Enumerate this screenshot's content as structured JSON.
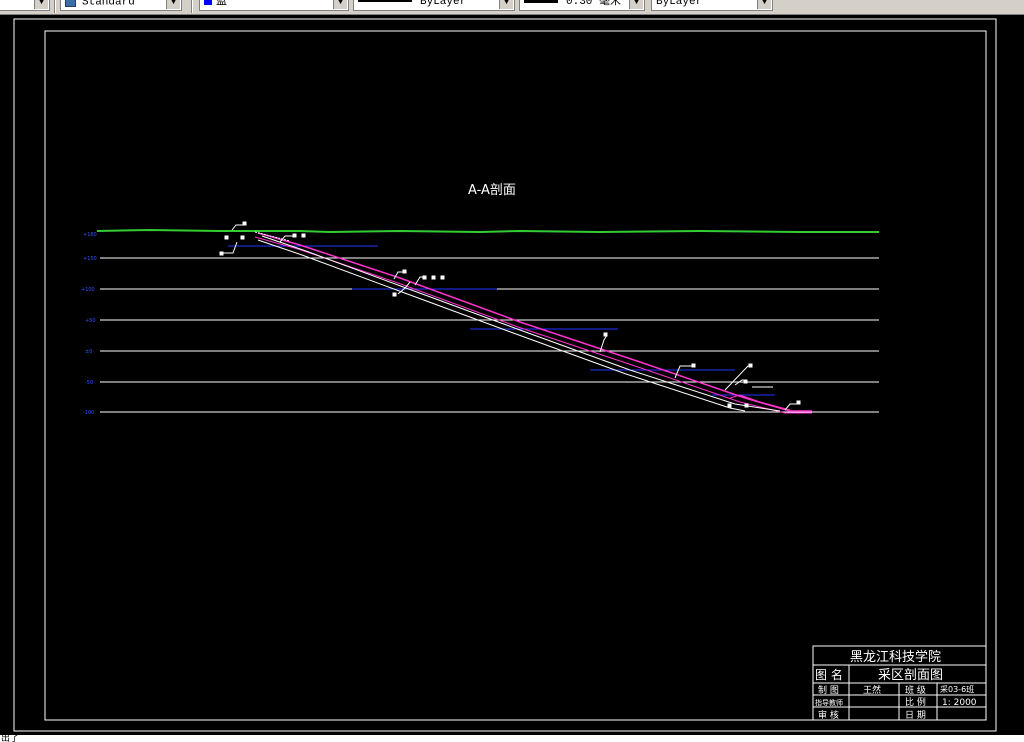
{
  "toolbar": {
    "text_style": "Standard",
    "color": "蓝",
    "color_hex": "#0000ff",
    "linetype": "ByLayer",
    "lineweight": "0.30 毫米",
    "plotstyle": "ByLayer"
  },
  "drawing": {
    "section_title": "A-A剖面",
    "elevation_labels": [
      "+180",
      "+150",
      "+100",
      "+50",
      "±0",
      "-50",
      "-100"
    ],
    "colors": {
      "background": "#000000",
      "border": "#ffffff",
      "ground_line": "#33cc33",
      "elevation_text": "#3355ff",
      "roadway_outer": "#ff33cc",
      "roadway_inner": "#ffffff",
      "seam_lines": "#2233ff"
    }
  },
  "title_block": {
    "school": "黑龙江科技学院",
    "drawing_name_label": "图  名",
    "drawing_name": "采区剖面图",
    "drafter_label": "制  图",
    "drafter": "王然",
    "class_label": "班  级",
    "class_value": "采03-6班",
    "advisor_label": "指导教师",
    "advisor": "",
    "scale_label": "比  例",
    "scale": "1: 2000",
    "reviewer_label": "审  核",
    "reviewer": "",
    "date_label": "日  期",
    "date": ""
  },
  "status": {
    "text": "出了"
  }
}
